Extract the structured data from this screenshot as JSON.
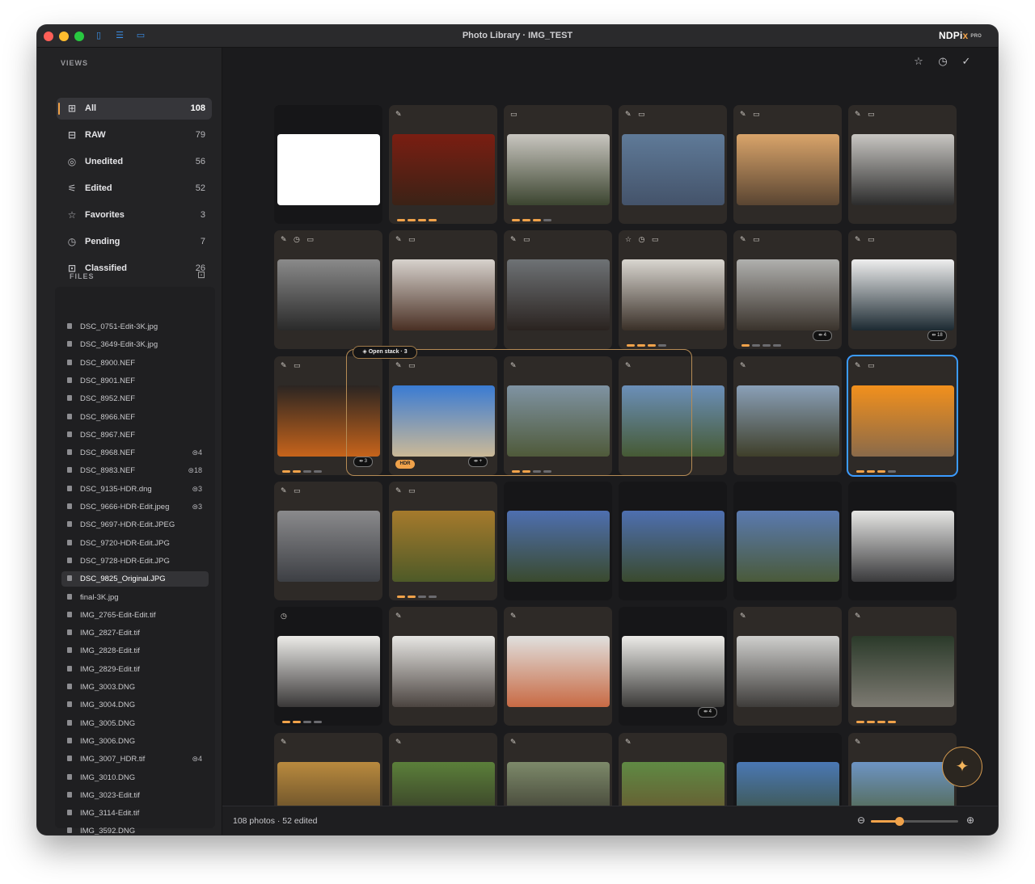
{
  "window": {
    "title": "Photo Library · IMG_TEST"
  },
  "brand": {
    "name": "NDPi",
    "mark": "x",
    "tier": "PRO"
  },
  "sidebar": {
    "views_label": "VIEWS",
    "views": [
      {
        "label": "All",
        "count": "108",
        "icon": "grid-icon",
        "glyph": "⊞",
        "active": true
      },
      {
        "label": "RAW",
        "count": "79",
        "icon": "raw-icon",
        "glyph": "⊟"
      },
      {
        "label": "Unedited",
        "count": "56",
        "icon": "unedited-icon",
        "glyph": "◎"
      },
      {
        "label": "Edited",
        "count": "52",
        "icon": "sliders-icon",
        "glyph": "⚟"
      },
      {
        "label": "Favorites",
        "count": "3",
        "icon": "star-icon",
        "glyph": "☆"
      },
      {
        "label": "Pending",
        "count": "7",
        "icon": "clock-icon",
        "glyph": "◷"
      },
      {
        "label": "Classified",
        "count": "26",
        "icon": "classified-icon",
        "glyph": "⊡"
      }
    ],
    "files_label": "FILES",
    "files": [
      {
        "name": "DSC_0751-Edit-3K.jpg"
      },
      {
        "name": "DSC_3649-Edit-3K.jpg"
      },
      {
        "name": "DSC_8900.NEF"
      },
      {
        "name": "DSC_8901.NEF"
      },
      {
        "name": "DSC_8952.NEF"
      },
      {
        "name": "DSC_8966.NEF"
      },
      {
        "name": "DSC_8967.NEF"
      },
      {
        "name": "DSC_8968.NEF",
        "stack": "4"
      },
      {
        "name": "DSC_8983.NEF",
        "stack": "18"
      },
      {
        "name": "DSC_9135-HDR.dng",
        "stack": "3"
      },
      {
        "name": "DSC_9666-HDR-Edit.jpeg",
        "stack": "3"
      },
      {
        "name": "DSC_9697-HDR-Edit.JPEG"
      },
      {
        "name": "DSC_9720-HDR-Edit.JPG"
      },
      {
        "name": "DSC_9728-HDR-Edit.JPG"
      },
      {
        "name": "DSC_9825_Original.JPG",
        "selected": true
      },
      {
        "name": "final-3K.jpg"
      },
      {
        "name": "IMG_2765-Edit-Edit.tif"
      },
      {
        "name": "IMG_2827-Edit.tif"
      },
      {
        "name": "IMG_2828-Edit.tif"
      },
      {
        "name": "IMG_2829-Edit.tif"
      },
      {
        "name": "IMG_3003.DNG"
      },
      {
        "name": "IMG_3004.DNG"
      },
      {
        "name": "IMG_3005.DNG"
      },
      {
        "name": "IMG_3006.DNG"
      },
      {
        "name": "IMG_3007_HDR.tif",
        "stack": "4"
      },
      {
        "name": "IMG_3010.DNG"
      },
      {
        "name": "IMG_3023-Edit.tif"
      },
      {
        "name": "IMG_3114-Edit.tif"
      },
      {
        "name": "IMG_3592.DNG"
      }
    ]
  },
  "toolbar": {
    "favorite_icon": "star-icon",
    "history_icon": "clock-icon",
    "done_icon": "check-icon"
  },
  "grid": {
    "open_stack_label": "Open stack · 3",
    "photos": [
      {
        "icons": "",
        "colors": [
          "#ffffff",
          "#ffffff"
        ],
        "dark": true
      },
      {
        "icons": "✎",
        "colors": [
          "#7a1e12",
          "#3b2216"
        ],
        "dots": [
          1,
          1,
          1,
          1
        ]
      },
      {
        "icons": "▭",
        "colors": [
          "#c9c6c0",
          "#3c4530"
        ],
        "dots": [
          1,
          1,
          1,
          0
        ]
      },
      {
        "icons": "✎ ▭",
        "colors": [
          "#5f7a98",
          "#44536a"
        ]
      },
      {
        "icons": "✎ ▭",
        "colors": [
          "#d9a46a",
          "#5a4532"
        ]
      },
      {
        "icons": "✎ ▭",
        "colors": [
          "#c8c6c2",
          "#2c2c2c"
        ]
      },
      {
        "icons": "✎ ◷ ▭",
        "colors": [
          "#8a8a8a",
          "#2a2a2a"
        ]
      },
      {
        "icons": "✎ ▭",
        "colors": [
          "#d7d2cd",
          "#4a3024"
        ]
      },
      {
        "icons": "✎ ▭",
        "colors": [
          "#6e7275",
          "#2a2320"
        ]
      },
      {
        "icons": "☆ ◷ ▭",
        "colors": [
          "#d9d6d0",
          "#3a3028"
        ],
        "dots": [
          1,
          1,
          1,
          0
        ]
      },
      {
        "icons": "✎ ▭",
        "colors": [
          "#b0b0ae",
          "#3a332c"
        ],
        "dots": [
          1,
          0,
          0,
          0
        ],
        "stack": "4"
      },
      {
        "icons": "✎ ▭",
        "colors": [
          "#eeeeee",
          "#1c2a32"
        ],
        "stack": "18"
      },
      {
        "icons": "✎ ▭",
        "colors": [
          "#2b2522",
          "#c7641b"
        ],
        "dots": [
          1,
          1,
          0,
          0
        ],
        "stack": "3"
      },
      {
        "icons": "✎ ▭",
        "colors": [
          "#3a7bd3",
          "#cbb997"
        ],
        "hdr": "HDR",
        "stack": "+"
      },
      {
        "icons": "✎",
        "colors": [
          "#7f93a3",
          "#4f5a3a"
        ],
        "dots": [
          1,
          1,
          0,
          0
        ]
      },
      {
        "icons": "✎",
        "colors": [
          "#6b8fb9",
          "#465a34"
        ]
      },
      {
        "icons": "✎",
        "colors": [
          "#8aa0b8",
          "#3f3f2a"
        ]
      },
      {
        "icons": "✎ ▭",
        "colors": [
          "#f2901c",
          "#8a6a4a"
        ],
        "dots": [
          1,
          1,
          1,
          0
        ],
        "selected": true
      },
      {
        "icons": "✎ ▭",
        "colors": [
          "#8a8a8c",
          "#3d3f44"
        ]
      },
      {
        "icons": "✎ ▭",
        "colors": [
          "#a67a2c",
          "#4e5a28"
        ],
        "dots": [
          1,
          1,
          0,
          0
        ]
      },
      {
        "icons": "",
        "colors": [
          "#4e6fb0",
          "#3a4a2e"
        ],
        "dark": true
      },
      {
        "icons": "",
        "colors": [
          "#4e6fb0",
          "#3a4a2e"
        ],
        "dark": true
      },
      {
        "icons": "",
        "colors": [
          "#5a7ab0",
          "#4a5a3a"
        ],
        "dark": true
      },
      {
        "icons": "",
        "colors": [
          "#e6e6e4",
          "#3a3a3c"
        ],
        "dark": true
      },
      {
        "icons": "◷",
        "colors": [
          "#ecebe8",
          "#3a3838"
        ],
        "dark": true,
        "dots": [
          1,
          1,
          0,
          0
        ]
      },
      {
        "icons": "✎",
        "colors": [
          "#e7e6e3",
          "#4b4440"
        ]
      },
      {
        "icons": "✎",
        "colors": [
          "#e0e0de",
          "#c86a44"
        ]
      },
      {
        "icons": "",
        "colors": [
          "#ecebe8",
          "#3b3a38"
        ],
        "dark": true,
        "stack": "4"
      },
      {
        "icons": "✎",
        "colors": [
          "#cfcfcd",
          "#3e3c3a"
        ]
      },
      {
        "icons": "✎",
        "colors": [
          "#2b3a2a",
          "#7d7a72"
        ],
        "dots": [
          1,
          1,
          1,
          1
        ]
      },
      {
        "icons": "✎",
        "colors": [
          "#b98a3e",
          "#4a3a22"
        ]
      },
      {
        "icons": "✎",
        "colors": [
          "#5b7f3a",
          "#2d2a22"
        ]
      },
      {
        "icons": "✎",
        "colors": [
          "#7d8a6a",
          "#2e2a24"
        ]
      },
      {
        "icons": "✎",
        "colors": [
          "#5f8a44",
          "#6a4a2a"
        ]
      },
      {
        "icons": "",
        "colors": [
          "#4a78b4",
          "#3a4a2a"
        ],
        "dark": true
      },
      {
        "icons": "✎",
        "colors": [
          "#6d94c4",
          "#4a5a2a"
        ]
      }
    ]
  },
  "status": {
    "text": "108 photos · 52 edited"
  },
  "zoom": {
    "level": 0.32,
    "out_icon": "zoom-out-icon",
    "in_icon": "zoom-in-icon"
  },
  "assistant": {
    "icon": "sparkle-icon"
  }
}
